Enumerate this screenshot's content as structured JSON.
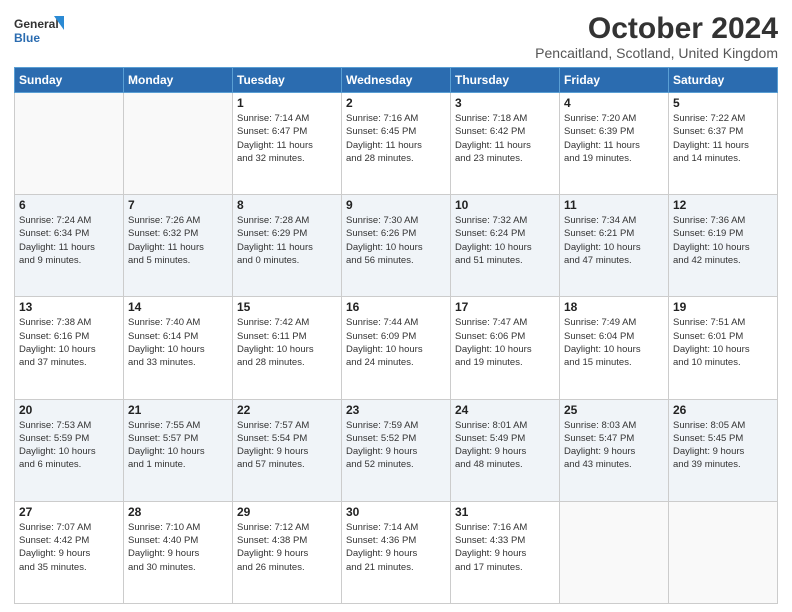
{
  "logo": {
    "line1": "General",
    "line2": "Blue"
  },
  "header": {
    "title": "October 2024",
    "location": "Pencaitland, Scotland, United Kingdom"
  },
  "days_of_week": [
    "Sunday",
    "Monday",
    "Tuesday",
    "Wednesday",
    "Thursday",
    "Friday",
    "Saturday"
  ],
  "weeks": [
    {
      "days": [
        {
          "num": "",
          "lines": []
        },
        {
          "num": "",
          "lines": []
        },
        {
          "num": "1",
          "lines": [
            "Sunrise: 7:14 AM",
            "Sunset: 6:47 PM",
            "Daylight: 11 hours",
            "and 32 minutes."
          ]
        },
        {
          "num": "2",
          "lines": [
            "Sunrise: 7:16 AM",
            "Sunset: 6:45 PM",
            "Daylight: 11 hours",
            "and 28 minutes."
          ]
        },
        {
          "num": "3",
          "lines": [
            "Sunrise: 7:18 AM",
            "Sunset: 6:42 PM",
            "Daylight: 11 hours",
            "and 23 minutes."
          ]
        },
        {
          "num": "4",
          "lines": [
            "Sunrise: 7:20 AM",
            "Sunset: 6:39 PM",
            "Daylight: 11 hours",
            "and 19 minutes."
          ]
        },
        {
          "num": "5",
          "lines": [
            "Sunrise: 7:22 AM",
            "Sunset: 6:37 PM",
            "Daylight: 11 hours",
            "and 14 minutes."
          ]
        }
      ]
    },
    {
      "days": [
        {
          "num": "6",
          "lines": [
            "Sunrise: 7:24 AM",
            "Sunset: 6:34 PM",
            "Daylight: 11 hours",
            "and 9 minutes."
          ]
        },
        {
          "num": "7",
          "lines": [
            "Sunrise: 7:26 AM",
            "Sunset: 6:32 PM",
            "Daylight: 11 hours",
            "and 5 minutes."
          ]
        },
        {
          "num": "8",
          "lines": [
            "Sunrise: 7:28 AM",
            "Sunset: 6:29 PM",
            "Daylight: 11 hours",
            "and 0 minutes."
          ]
        },
        {
          "num": "9",
          "lines": [
            "Sunrise: 7:30 AM",
            "Sunset: 6:26 PM",
            "Daylight: 10 hours",
            "and 56 minutes."
          ]
        },
        {
          "num": "10",
          "lines": [
            "Sunrise: 7:32 AM",
            "Sunset: 6:24 PM",
            "Daylight: 10 hours",
            "and 51 minutes."
          ]
        },
        {
          "num": "11",
          "lines": [
            "Sunrise: 7:34 AM",
            "Sunset: 6:21 PM",
            "Daylight: 10 hours",
            "and 47 minutes."
          ]
        },
        {
          "num": "12",
          "lines": [
            "Sunrise: 7:36 AM",
            "Sunset: 6:19 PM",
            "Daylight: 10 hours",
            "and 42 minutes."
          ]
        }
      ]
    },
    {
      "days": [
        {
          "num": "13",
          "lines": [
            "Sunrise: 7:38 AM",
            "Sunset: 6:16 PM",
            "Daylight: 10 hours",
            "and 37 minutes."
          ]
        },
        {
          "num": "14",
          "lines": [
            "Sunrise: 7:40 AM",
            "Sunset: 6:14 PM",
            "Daylight: 10 hours",
            "and 33 minutes."
          ]
        },
        {
          "num": "15",
          "lines": [
            "Sunrise: 7:42 AM",
            "Sunset: 6:11 PM",
            "Daylight: 10 hours",
            "and 28 minutes."
          ]
        },
        {
          "num": "16",
          "lines": [
            "Sunrise: 7:44 AM",
            "Sunset: 6:09 PM",
            "Daylight: 10 hours",
            "and 24 minutes."
          ]
        },
        {
          "num": "17",
          "lines": [
            "Sunrise: 7:47 AM",
            "Sunset: 6:06 PM",
            "Daylight: 10 hours",
            "and 19 minutes."
          ]
        },
        {
          "num": "18",
          "lines": [
            "Sunrise: 7:49 AM",
            "Sunset: 6:04 PM",
            "Daylight: 10 hours",
            "and 15 minutes."
          ]
        },
        {
          "num": "19",
          "lines": [
            "Sunrise: 7:51 AM",
            "Sunset: 6:01 PM",
            "Daylight: 10 hours",
            "and 10 minutes."
          ]
        }
      ]
    },
    {
      "days": [
        {
          "num": "20",
          "lines": [
            "Sunrise: 7:53 AM",
            "Sunset: 5:59 PM",
            "Daylight: 10 hours",
            "and 6 minutes."
          ]
        },
        {
          "num": "21",
          "lines": [
            "Sunrise: 7:55 AM",
            "Sunset: 5:57 PM",
            "Daylight: 10 hours",
            "and 1 minute."
          ]
        },
        {
          "num": "22",
          "lines": [
            "Sunrise: 7:57 AM",
            "Sunset: 5:54 PM",
            "Daylight: 9 hours",
            "and 57 minutes."
          ]
        },
        {
          "num": "23",
          "lines": [
            "Sunrise: 7:59 AM",
            "Sunset: 5:52 PM",
            "Daylight: 9 hours",
            "and 52 minutes."
          ]
        },
        {
          "num": "24",
          "lines": [
            "Sunrise: 8:01 AM",
            "Sunset: 5:49 PM",
            "Daylight: 9 hours",
            "and 48 minutes."
          ]
        },
        {
          "num": "25",
          "lines": [
            "Sunrise: 8:03 AM",
            "Sunset: 5:47 PM",
            "Daylight: 9 hours",
            "and 43 minutes."
          ]
        },
        {
          "num": "26",
          "lines": [
            "Sunrise: 8:05 AM",
            "Sunset: 5:45 PM",
            "Daylight: 9 hours",
            "and 39 minutes."
          ]
        }
      ]
    },
    {
      "days": [
        {
          "num": "27",
          "lines": [
            "Sunrise: 7:07 AM",
            "Sunset: 4:42 PM",
            "Daylight: 9 hours",
            "and 35 minutes."
          ]
        },
        {
          "num": "28",
          "lines": [
            "Sunrise: 7:10 AM",
            "Sunset: 4:40 PM",
            "Daylight: 9 hours",
            "and 30 minutes."
          ]
        },
        {
          "num": "29",
          "lines": [
            "Sunrise: 7:12 AM",
            "Sunset: 4:38 PM",
            "Daylight: 9 hours",
            "and 26 minutes."
          ]
        },
        {
          "num": "30",
          "lines": [
            "Sunrise: 7:14 AM",
            "Sunset: 4:36 PM",
            "Daylight: 9 hours",
            "and 21 minutes."
          ]
        },
        {
          "num": "31",
          "lines": [
            "Sunrise: 7:16 AM",
            "Sunset: 4:33 PM",
            "Daylight: 9 hours",
            "and 17 minutes."
          ]
        },
        {
          "num": "",
          "lines": []
        },
        {
          "num": "",
          "lines": []
        }
      ]
    }
  ]
}
